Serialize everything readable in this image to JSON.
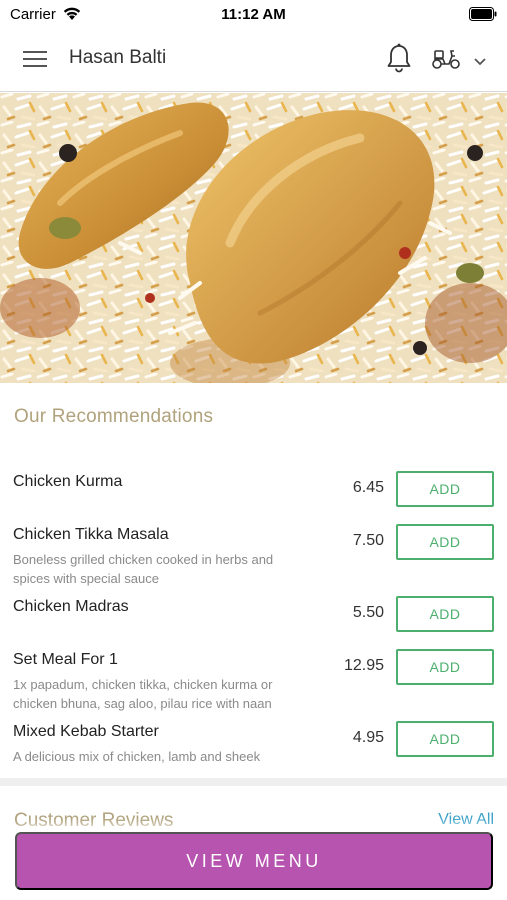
{
  "status_bar": {
    "carrier": "Carrier",
    "time": "11:12 AM",
    "icons": [
      "wifi-icon",
      "battery-icon"
    ]
  },
  "header": {
    "title": "Hasan Balti",
    "icons": [
      "menu-icon",
      "bell-icon",
      "scooter-icon",
      "chevron-down-icon"
    ]
  },
  "hero": {
    "image": "chicken-biryani-photo"
  },
  "recommendations": {
    "title": "Our Recommendations",
    "items": [
      {
        "name": "Chicken Kurma",
        "description": "",
        "price": "6.45",
        "add_label": "ADD"
      },
      {
        "name": "Chicken Tikka Masala",
        "description": "Boneless grilled chicken cooked in herbs and spices with special sauce",
        "price": "7.50",
        "add_label": "ADD"
      },
      {
        "name": "Chicken Madras",
        "description": "",
        "price": "5.50",
        "add_label": "ADD"
      },
      {
        "name": "Set Meal For 1",
        "description": "1x papadum, chicken tikka, chicken kurma or chicken bhuna, sag aloo, pilau rice with naan",
        "price": "12.95",
        "add_label": "ADD"
      },
      {
        "name": "Mixed Kebab Starter",
        "description": "A delicious mix of chicken, lamb and sheek",
        "price": "4.95",
        "add_label": "ADD"
      }
    ]
  },
  "reviews": {
    "title": "Customer Reviews",
    "view_all_label": "View All"
  },
  "footer": {
    "view_menu_label": "VIEW MENU"
  },
  "colors": {
    "accent_purple": "#b654b0",
    "add_green": "#4caf6e",
    "section_gold": "#b0a27c",
    "link_blue": "#3aa0c8"
  }
}
